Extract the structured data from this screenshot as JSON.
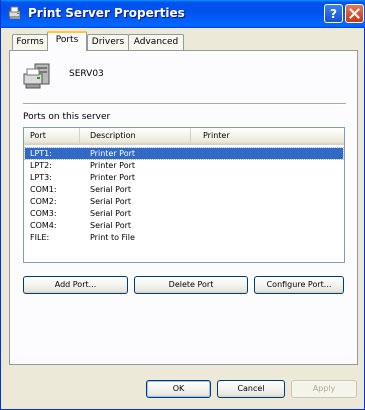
{
  "window": {
    "title": "Print Server Properties",
    "icons": {
      "app": "printer-server-icon",
      "help": "help-icon",
      "close": "close-icon"
    }
  },
  "tabs": [
    {
      "label": "Forms",
      "active": false
    },
    {
      "label": "Ports",
      "active": true
    },
    {
      "label": "Drivers",
      "active": false
    },
    {
      "label": "Advanced",
      "active": false
    }
  ],
  "server": {
    "name": "SERV03",
    "icon": "printer-server-icon"
  },
  "ports_section": {
    "label": "Ports on this server",
    "columns": [
      "Port",
      "Description",
      "Printer"
    ],
    "rows": [
      {
        "port": "LPT1:",
        "description": "Printer Port",
        "printer": "",
        "selected": true
      },
      {
        "port": "LPT2:",
        "description": "Printer Port",
        "printer": "",
        "selected": false
      },
      {
        "port": "LPT3:",
        "description": "Printer Port",
        "printer": "",
        "selected": false
      },
      {
        "port": "COM1:",
        "description": "Serial Port",
        "printer": "",
        "selected": false
      },
      {
        "port": "COM2:",
        "description": "Serial Port",
        "printer": "",
        "selected": false
      },
      {
        "port": "COM3:",
        "description": "Serial Port",
        "printer": "",
        "selected": false
      },
      {
        "port": "COM4:",
        "description": "Serial Port",
        "printer": "",
        "selected": false
      },
      {
        "port": "FILE:",
        "description": "Print to File",
        "printer": "",
        "selected": false
      }
    ]
  },
  "port_buttons": {
    "add": "Add Port...",
    "delete": "Delete Port",
    "configure": "Configure Port..."
  },
  "dialog_buttons": {
    "ok": "OK",
    "cancel": "Cancel",
    "apply": "Apply"
  },
  "colors": {
    "titlebar": "#0054E3",
    "selection": "#316AC5",
    "dialog_bg": "#ECE9D8",
    "panel_bg": "#FCFCFE",
    "tab_highlight": "#FFC83C"
  }
}
